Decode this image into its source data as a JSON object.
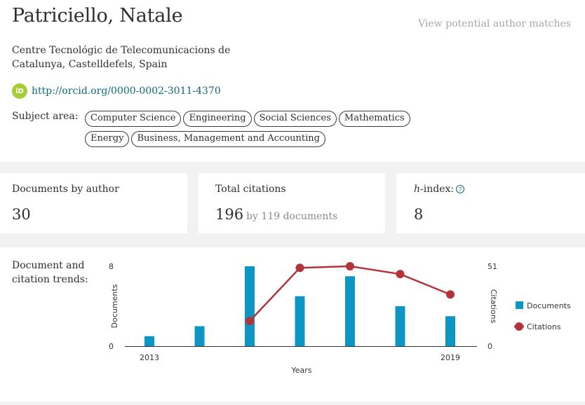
{
  "profile": {
    "name": "Patriciello, Natale",
    "potential_link": "View potential author matches",
    "affiliation": "Centre Tecnológic de Telecomunicacions de Catalunya, Castelldefels, Spain",
    "orcid_icon_text": "iD",
    "orcid_url": "http://orcid.org/0000-0002-3011-4370",
    "subject_label": "Subject area:",
    "subjects": [
      "Computer Science",
      "Engineering",
      "Social Sciences",
      "Mathematics",
      "Energy",
      "Business, Management and Accounting"
    ]
  },
  "metrics": {
    "documents": {
      "label": "Documents by author",
      "value": "30"
    },
    "citations": {
      "label": "Total citations",
      "value": "196",
      "sub": "by 119 documents"
    },
    "hindex": {
      "label_h": "h",
      "label_rest": "-index:",
      "info_icon": "?",
      "value": "8"
    }
  },
  "trends": {
    "label": "Document and citation trends:"
  },
  "chart_data": {
    "type": "bar",
    "x": [
      2013,
      2014,
      2015,
      2016,
      2017,
      2018,
      2019
    ],
    "xtick_labels": [
      "2013",
      "2019"
    ],
    "xlabel": "Years",
    "series": [
      {
        "name": "Documents",
        "type": "bar",
        "axis": "left",
        "values": [
          1,
          2,
          8,
          5,
          7,
          4,
          3
        ]
      },
      {
        "name": "Citations",
        "type": "line",
        "axis": "right",
        "values": [
          null,
          null,
          16,
          50,
          51,
          46,
          33
        ]
      }
    ],
    "y_left": {
      "label": "Documents",
      "range": [
        0,
        8
      ],
      "ticks": [
        "8",
        "0"
      ]
    },
    "y_right": {
      "label": "Citations",
      "range": [
        0,
        51
      ],
      "ticks": [
        "51",
        "0"
      ]
    },
    "legend": {
      "position": "right",
      "items": [
        "Documents",
        "Citations"
      ]
    },
    "grid": false,
    "colors": {
      "documents": "#0d96c4",
      "citations": "#b3333a",
      "axis": "#333333"
    }
  }
}
